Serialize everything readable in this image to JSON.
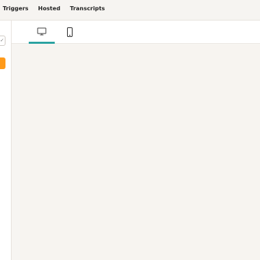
{
  "topnav": {
    "items": [
      "Triggers",
      "Hosted",
      "Transcripts"
    ]
  },
  "sidebar": {
    "select_chevron": "✓",
    "action_color": "#ff9a1a"
  },
  "device_tabs": {
    "desktop_icon": "desktop-icon",
    "mobile_icon": "mobile-icon",
    "active": "desktop",
    "accent_color": "#2aa1a0"
  }
}
